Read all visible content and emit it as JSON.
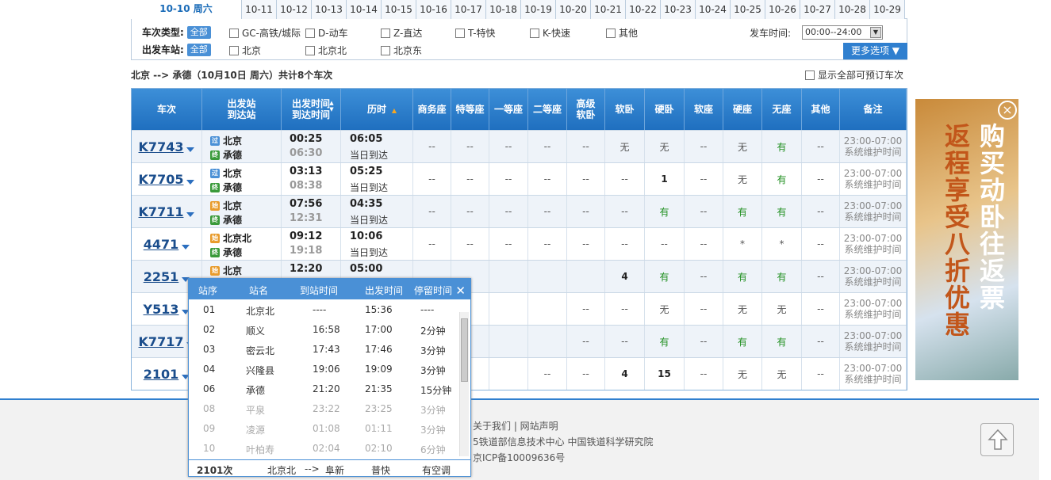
{
  "datebar": {
    "current": "10-10 周六",
    "dates": [
      "10-11",
      "10-12",
      "10-13",
      "10-14",
      "10-15",
      "10-16",
      "10-17",
      "10-18",
      "10-19",
      "10-20",
      "10-21",
      "10-22",
      "10-23",
      "10-24",
      "10-25",
      "10-26",
      "10-27",
      "10-28",
      "10-29"
    ]
  },
  "filters": {
    "type_label": "车次类型:",
    "all": "全部",
    "types": [
      "GC-高铁/城际",
      "D-动车",
      "Z-直达",
      "T-特快",
      "K-快速",
      "其他"
    ],
    "station_label": "出发车站:",
    "stations": [
      "北京",
      "北京北",
      "北京东"
    ],
    "time_label": "发车时间:",
    "time_value": "00:00--24:00",
    "more": "更多选项"
  },
  "route": {
    "text": "北京 --> 承德（10月10日  周六）共计8个车次",
    "show_all": "显示全部可预订车次"
  },
  "headers": [
    "车次",
    "出发站 到达站",
    "出发时间 到达时间",
    "历时",
    "商务座",
    "特等座",
    "一等座",
    "二等座",
    "高级 软卧",
    "软卧",
    "硬卧",
    "软座",
    "硬座",
    "无座",
    "其他",
    "备注"
  ],
  "trains": [
    {
      "no": "K7743",
      "from": "北京",
      "to": "承德",
      "ftag": "过",
      "dep": "00:25",
      "arr": "06:30",
      "dur": "06:05",
      "day": "当日到达",
      "seats": [
        "--",
        "--",
        "--",
        "--",
        "--",
        "无",
        "无",
        "--",
        "无",
        "有",
        "--"
      ]
    },
    {
      "no": "K7705",
      "from": "北京",
      "to": "承德",
      "ftag": "过",
      "dep": "03:13",
      "arr": "08:38",
      "dur": "05:25",
      "day": "当日到达",
      "seats": [
        "--",
        "--",
        "--",
        "--",
        "--",
        "--",
        "1",
        "--",
        "无",
        "有",
        "--"
      ]
    },
    {
      "no": "K7711",
      "from": "北京",
      "to": "承德",
      "ftag": "始",
      "dep": "07:56",
      "arr": "12:31",
      "dur": "04:35",
      "day": "当日到达",
      "seats": [
        "--",
        "--",
        "--",
        "--",
        "--",
        "--",
        "有",
        "--",
        "有",
        "有",
        "--"
      ]
    },
    {
      "no": "4471",
      "from": "北京北",
      "to": "承德",
      "ftag": "始",
      "dep": "09:12",
      "arr": "19:18",
      "dur": "10:06",
      "day": "当日到达",
      "seats": [
        "--",
        "--",
        "--",
        "--",
        "--",
        "--",
        "--",
        "--",
        "*",
        "*",
        "--"
      ]
    },
    {
      "no": "2251",
      "from": "北京",
      "to": "",
      "ftag": "始",
      "dep": "12:20",
      "arr": "",
      "dur": "05:00",
      "day": "",
      "seats": [
        "",
        "",
        "",
        "",
        "",
        "4",
        "有",
        "--",
        "有",
        "有",
        "--"
      ]
    },
    {
      "no": "Y513",
      "from": "",
      "to": "",
      "ftag": "",
      "dep": "",
      "arr": "",
      "dur": "",
      "day": "",
      "seats": [
        "",
        "",
        "",
        "",
        "--",
        "--",
        "无",
        "--",
        "无",
        "无",
        "--"
      ]
    },
    {
      "no": "K7717",
      "from": "",
      "to": "",
      "ftag": "",
      "dep": "",
      "arr": "",
      "dur": "",
      "day": "",
      "seats": [
        "",
        "",
        "",
        "",
        "--",
        "--",
        "有",
        "--",
        "有",
        "有",
        "--"
      ]
    },
    {
      "no": "2101",
      "from": "",
      "to": "",
      "ftag": "",
      "dep": "",
      "arr": "",
      "dur": "",
      "day": "",
      "seats": [
        "",
        "",
        "",
        "--",
        "--",
        "4",
        "15",
        "--",
        "无",
        "无",
        "--"
      ]
    }
  ],
  "note": "23:00-07:00系统维护时间",
  "popup": {
    "headers": [
      "站序",
      "站名",
      "到站时间",
      "出发时间",
      "停留时间"
    ],
    "rows": [
      {
        "seq": "01",
        "name": "北京北",
        "arr": "----",
        "dep": "15:36",
        "stay": "----",
        "dim": false
      },
      {
        "seq": "02",
        "name": "顺义",
        "arr": "16:58",
        "dep": "17:00",
        "stay": "2分钟",
        "dim": false
      },
      {
        "seq": "03",
        "name": "密云北",
        "arr": "17:43",
        "dep": "17:46",
        "stay": "3分钟",
        "dim": false
      },
      {
        "seq": "04",
        "name": "兴隆县",
        "arr": "19:06",
        "dep": "19:09",
        "stay": "3分钟",
        "dim": false
      },
      {
        "seq": "06",
        "name": "承德",
        "arr": "21:20",
        "dep": "21:35",
        "stay": "15分钟",
        "dim": false
      },
      {
        "seq": "08",
        "name": "平泉",
        "arr": "23:22",
        "dep": "23:25",
        "stay": "3分钟",
        "dim": true
      },
      {
        "seq": "09",
        "name": "凌源",
        "arr": "01:08",
        "dep": "01:11",
        "stay": "3分钟",
        "dim": true
      },
      {
        "seq": "10",
        "name": "叶柏寿",
        "arr": "02:04",
        "dep": "02:10",
        "stay": "6分钟",
        "dim": true
      }
    ],
    "footer": {
      "train": "2101次",
      "from": "北京北",
      "arrow": "-->",
      "to": "阜新",
      "kind": "普快",
      "ac": "有空调"
    }
  },
  "footer": {
    "links": "关于我们  |  网站声明",
    "org": "5铁道部信息技术中心   中国铁道科学研究院",
    "icp": "京ICP备10009636号"
  },
  "ad": {
    "line1": "购买动卧往返票",
    "line2": "返程享受八折优惠"
  }
}
